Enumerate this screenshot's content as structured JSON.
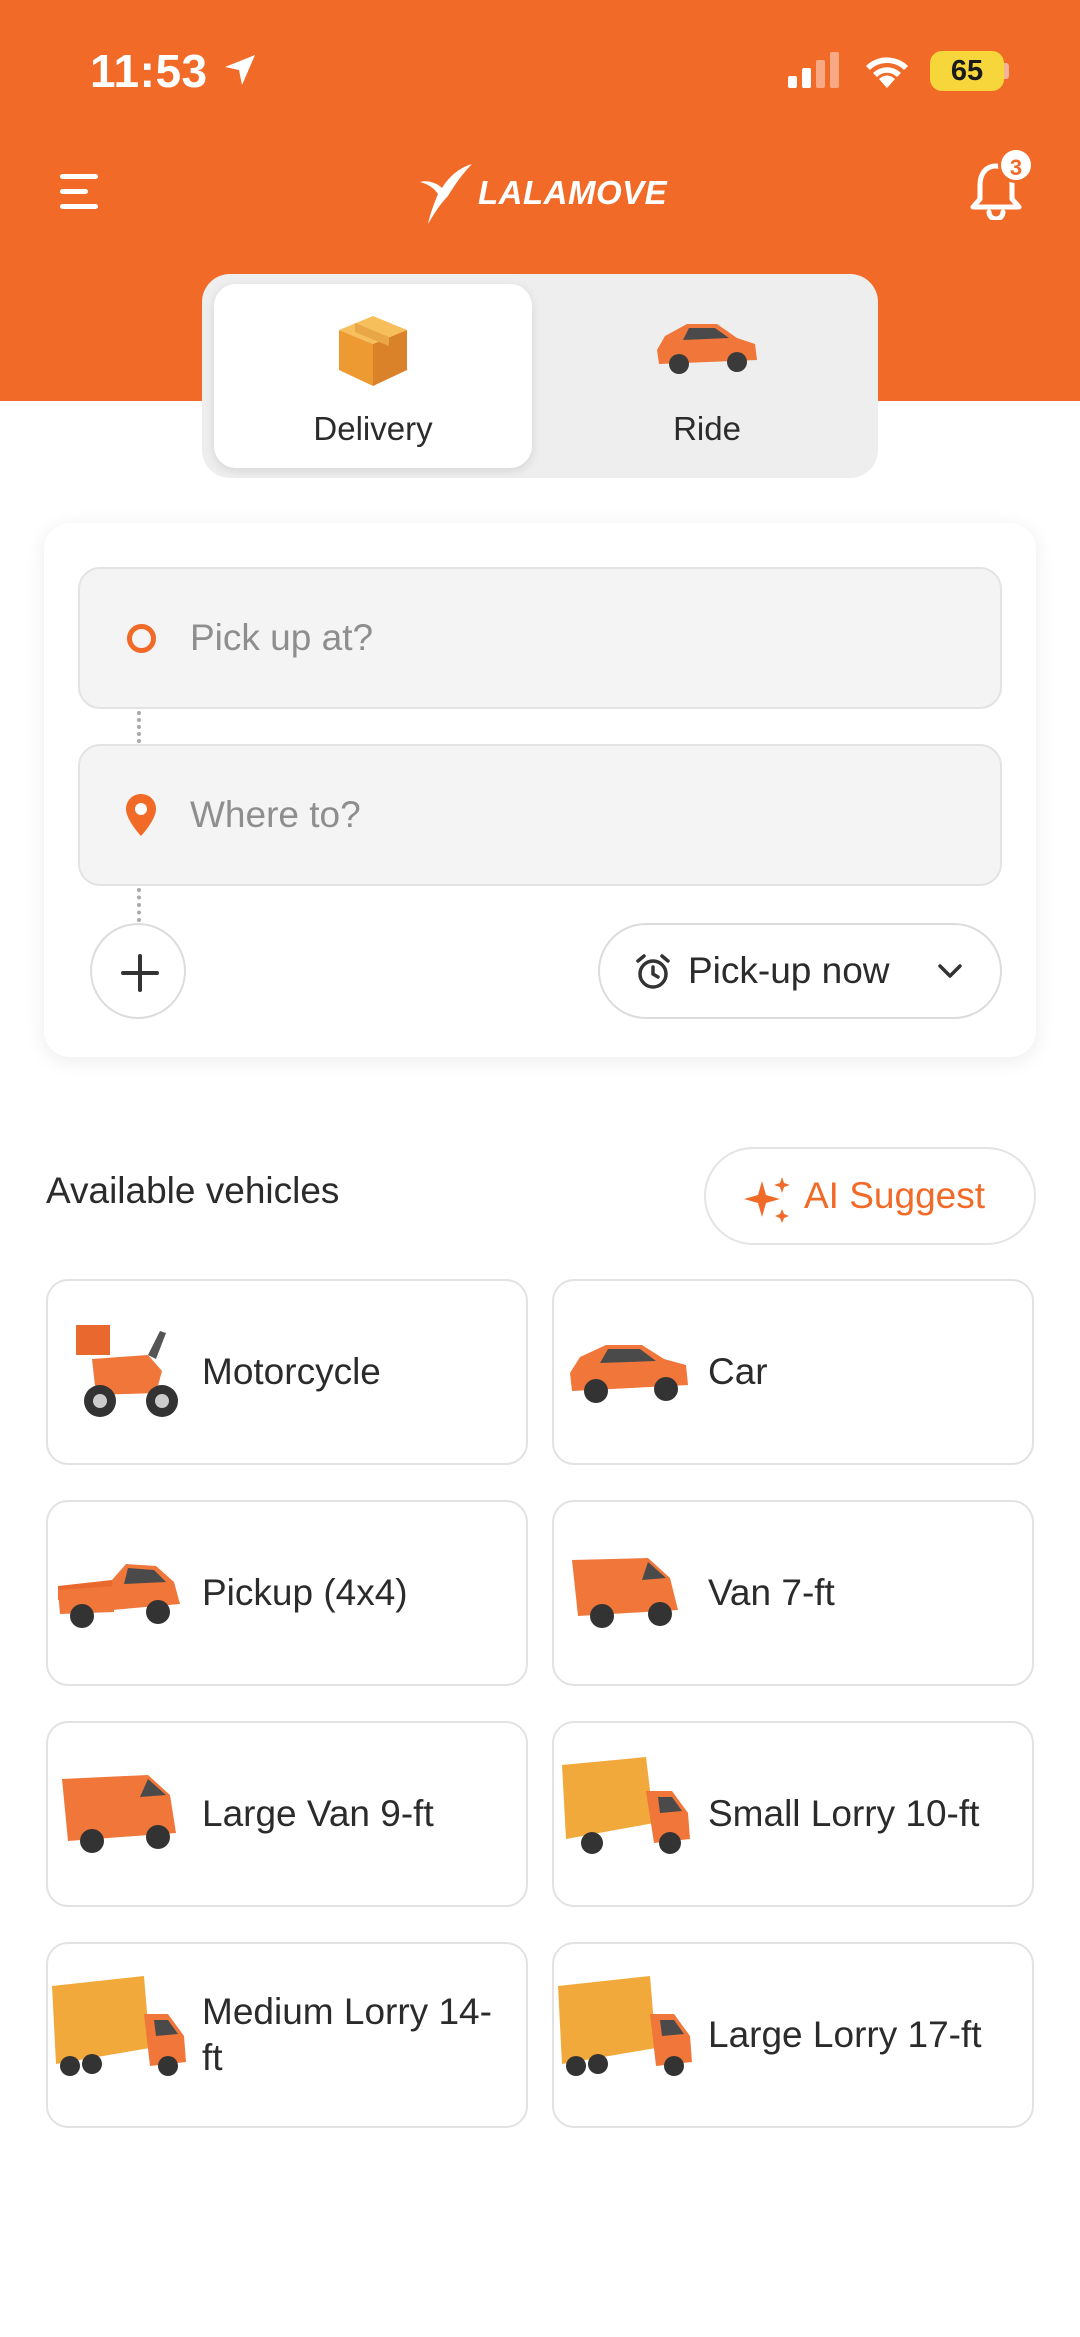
{
  "status_bar": {
    "time": "11:53",
    "battery": "65"
  },
  "header": {
    "brand": "LALAMOVE",
    "notification_count": "3"
  },
  "mode_tabs": [
    {
      "label": "Delivery",
      "active": true
    },
    {
      "label": "Ride",
      "active": false
    }
  ],
  "route": {
    "pickup_placeholder": "Pick up at?",
    "dropoff_placeholder": "Where to?",
    "pickup_time": "Pick-up now"
  },
  "vehicles_section": {
    "title": "Available vehicles",
    "ai_suggest": "AI Suggest",
    "items": [
      {
        "label": "Motorcycle",
        "icon": "motorcycle-icon"
      },
      {
        "label": "Car",
        "icon": "car-icon"
      },
      {
        "label": "Pickup (4x4)",
        "icon": "pickup-truck-icon"
      },
      {
        "label": "Van 7-ft",
        "icon": "van-icon"
      },
      {
        "label": "Large Van 9-ft",
        "icon": "large-van-icon"
      },
      {
        "label": "Small Lorry 10-ft",
        "icon": "small-lorry-icon"
      },
      {
        "label": "Medium Lorry 14-ft",
        "icon": "medium-lorry-icon"
      },
      {
        "label": "Large Lorry 17-ft",
        "icon": "large-lorry-icon"
      }
    ]
  },
  "colors": {
    "accent": "#F26A28",
    "battery": "#F6D63A",
    "lorry_body": "#F2A93B"
  }
}
